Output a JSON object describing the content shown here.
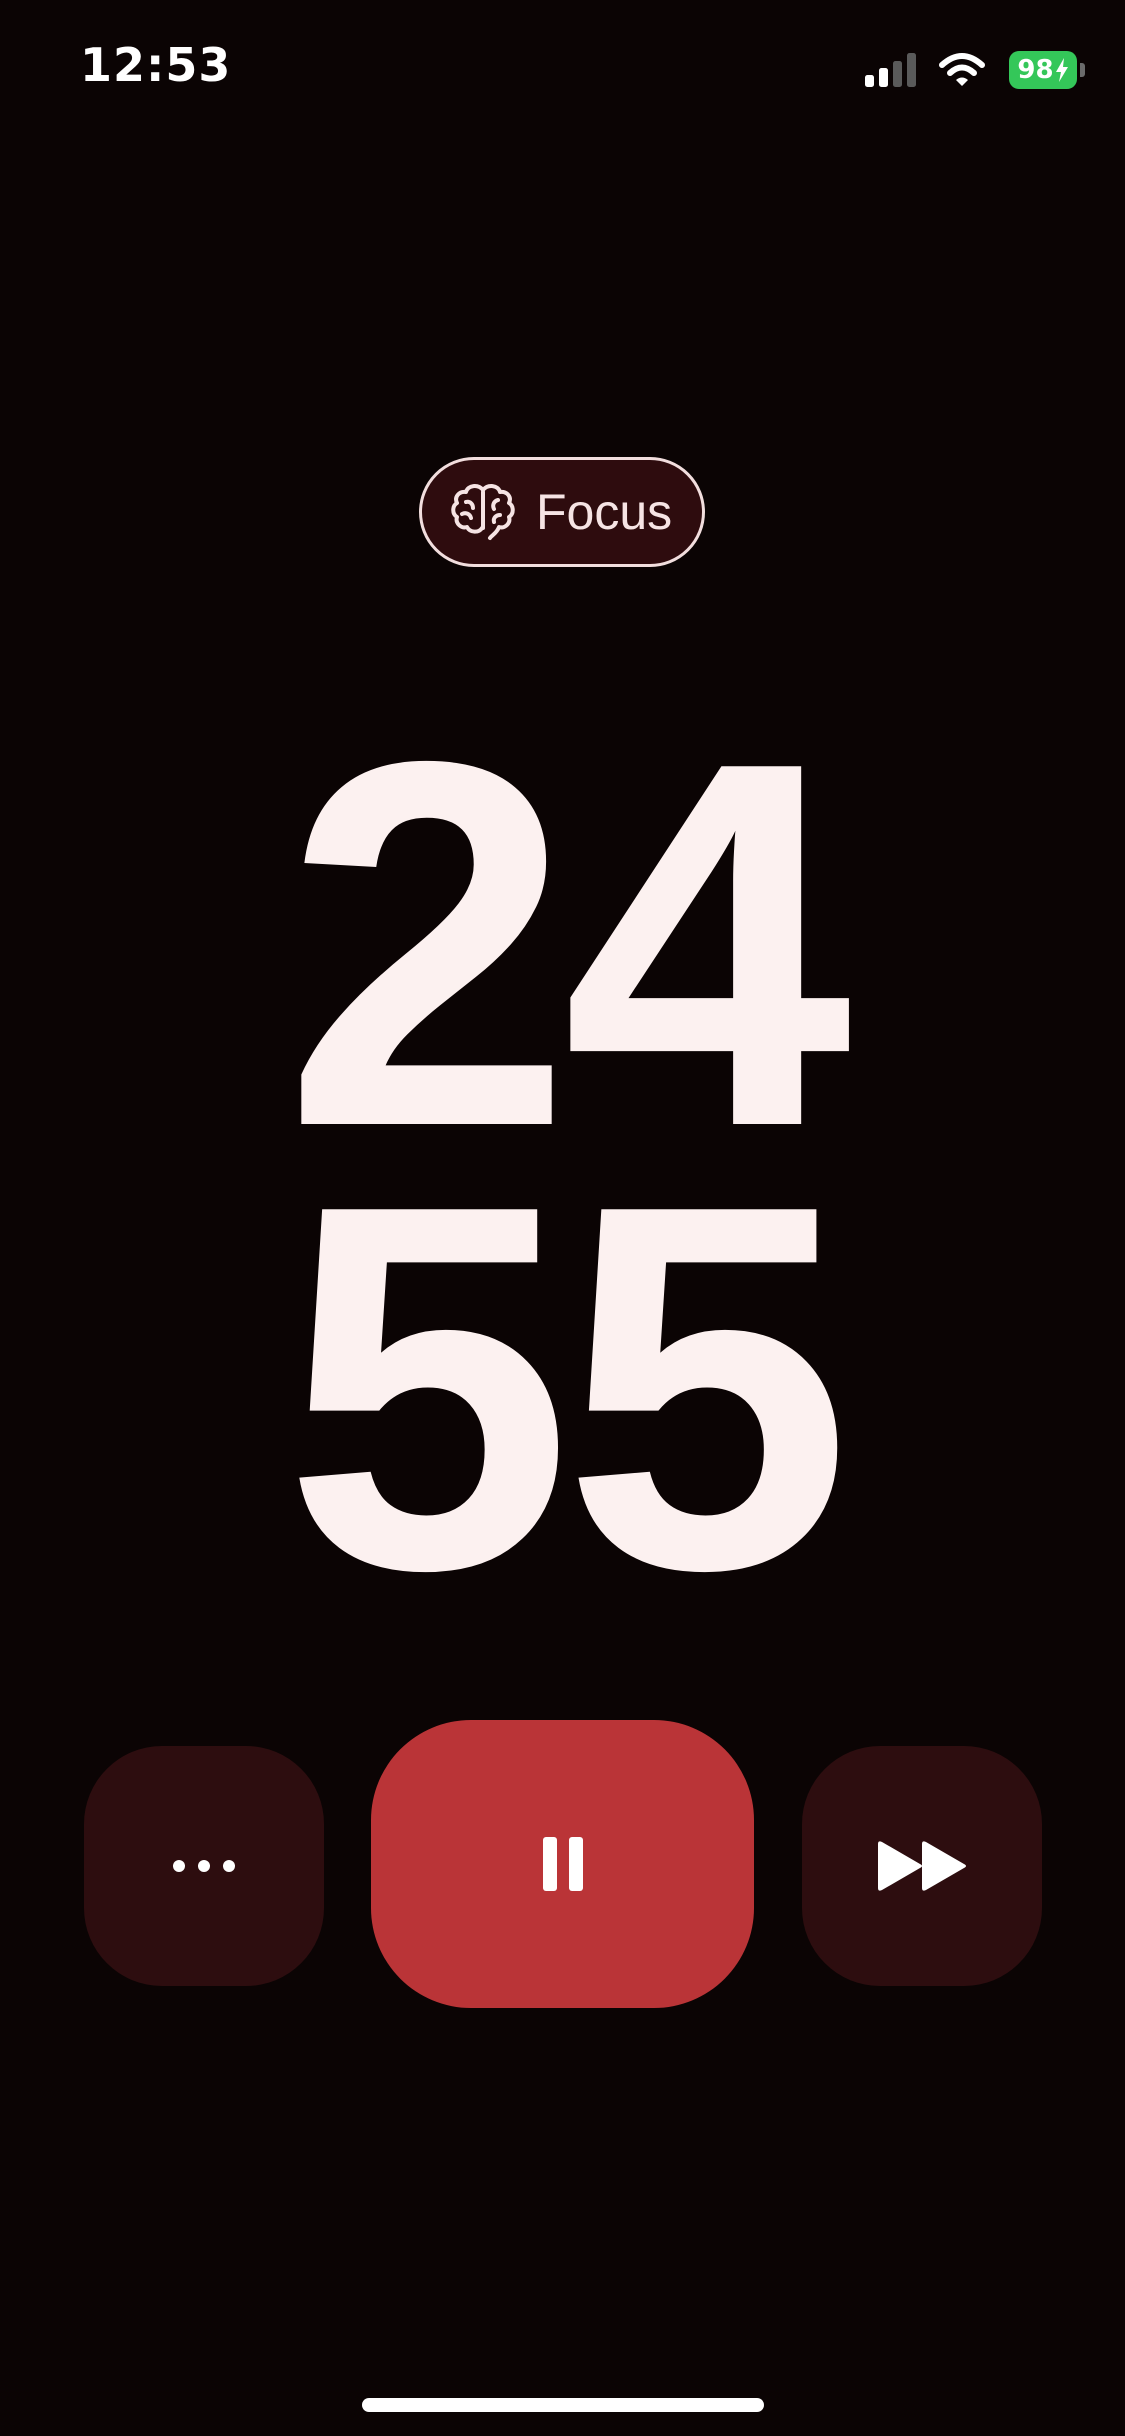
{
  "status_bar": {
    "time": "12:53",
    "battery_percent": "98",
    "battery_charging": true,
    "battery_color": "#34c759",
    "signal_bars_active": 2,
    "signal_bars_total": 4,
    "icons": [
      "signal-bars-icon",
      "wifi-icon",
      "battery-icon",
      "bolt-icon"
    ]
  },
  "mode": {
    "label": "Focus",
    "icon": "brain-icon",
    "pill_border_color": "#f2dede",
    "pill_background": "#2e0c0e"
  },
  "timer": {
    "minutes": "24",
    "seconds": "55",
    "digit_color": "#fcf1f0"
  },
  "controls": {
    "more": {
      "icon": "ellipsis-icon",
      "background": "#2d0d0f"
    },
    "pause": {
      "icon": "pause-icon",
      "background": "#ba3437"
    },
    "skip": {
      "icon": "fast-forward-icon",
      "background": "#2d0d0f"
    }
  },
  "theme": {
    "background": "#0b0404",
    "accent": "#ba3437"
  }
}
